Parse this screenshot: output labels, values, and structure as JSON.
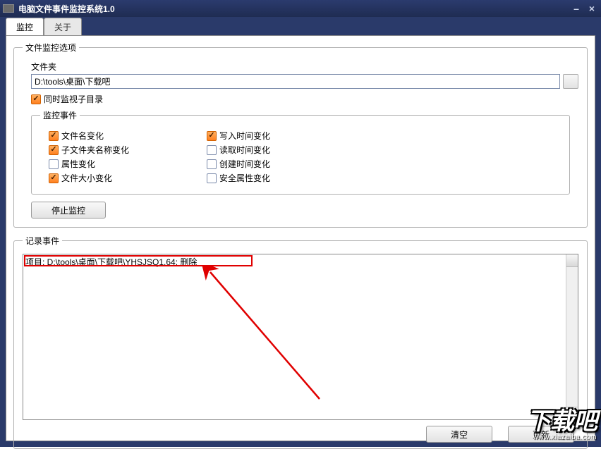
{
  "window": {
    "title": "电脑文件事件监控系统1.0"
  },
  "tabs": {
    "monitor": "监控",
    "about": "关于"
  },
  "options": {
    "legend": "文件监控选项",
    "folder_label": "文件夹",
    "folder_path": "D:\\tools\\桌面\\下载吧",
    "watch_sub": "同时监视子目录"
  },
  "events": {
    "legend": "监控事件",
    "filename": "文件名变化",
    "subfolder": "子文件夹名称变化",
    "attr": "属性变化",
    "filesize": "文件大小变化",
    "writetime": "写入时间变化",
    "readtime": "读取时间变化",
    "createtime": "创建时间变化",
    "secattr": "安全属性变化"
  },
  "buttons": {
    "stop": "停止监控",
    "clear": "清空",
    "update": "更新"
  },
  "log": {
    "legend": "记录事件",
    "line1": "项目: D:\\tools\\桌面\\下载吧\\YHSJSQ1.64; 删除"
  },
  "watermark": {
    "main": "下载吧",
    "sub": "www.xiazaiba.com"
  }
}
